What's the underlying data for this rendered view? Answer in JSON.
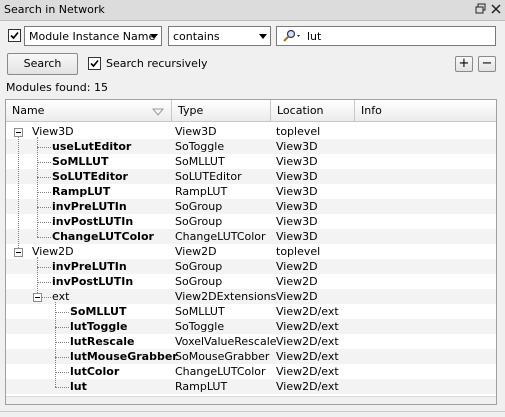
{
  "window": {
    "title": "Search in Network"
  },
  "filter": {
    "enabled": true,
    "field": "Module Instance Name",
    "operator": "contains",
    "query": "lut"
  },
  "search_button": "Search",
  "recursive": {
    "checked": true,
    "label": "Search recursively"
  },
  "buttons": {
    "add": "+",
    "remove": "−"
  },
  "modules_found": "Modules found: 15",
  "columns": [
    "Name",
    "Type",
    "Location",
    "Info"
  ],
  "rows": [
    {
      "name": "View3D",
      "type": "View3D",
      "location": "toplevel",
      "bold": false
    },
    {
      "name": "useLutEditor",
      "type": "SoToggle",
      "location": "View3D",
      "bold": true
    },
    {
      "name": "SoMLLUT",
      "type": "SoMLLUT",
      "location": "View3D",
      "bold": true
    },
    {
      "name": "SoLUTEditor",
      "type": "SoLUTEditor",
      "location": "View3D",
      "bold": true
    },
    {
      "name": "RampLUT",
      "type": "RampLUT",
      "location": "View3D",
      "bold": true
    },
    {
      "name": "invPreLUTIn",
      "type": "SoGroup",
      "location": "View3D",
      "bold": true
    },
    {
      "name": "invPostLUTIn",
      "type": "SoGroup",
      "location": "View3D",
      "bold": true
    },
    {
      "name": "ChangeLUTColor",
      "type": "ChangeLUTColor",
      "location": "View3D",
      "bold": true
    },
    {
      "name": "View2D",
      "type": "View2D",
      "location": "toplevel",
      "bold": false
    },
    {
      "name": "invPreLUTIn",
      "type": "SoGroup",
      "location": "View2D",
      "bold": true
    },
    {
      "name": "invPostLUTIn",
      "type": "SoGroup",
      "location": "View2D",
      "bold": true
    },
    {
      "name": "ext",
      "type": "View2DExtensions",
      "location": "View2D",
      "bold": false
    },
    {
      "name": "SoMLLUT",
      "type": "SoMLLUT",
      "location": "View2D/ext",
      "bold": true
    },
    {
      "name": "lutToggle",
      "type": "SoToggle",
      "location": "View2D/ext",
      "bold": true
    },
    {
      "name": "lutRescale",
      "type": "VoxelValueRescale",
      "location": "View2D/ext",
      "bold": true
    },
    {
      "name": "lutMouseGrabber",
      "type": "SoMouseGrabber",
      "location": "View2D/ext",
      "bold": true
    },
    {
      "name": "lutColor",
      "type": "ChangeLUTColor",
      "location": "View2D/ext",
      "bold": true
    },
    {
      "name": "lut",
      "type": "RampLUT",
      "location": "View2D/ext",
      "bold": true
    }
  ]
}
